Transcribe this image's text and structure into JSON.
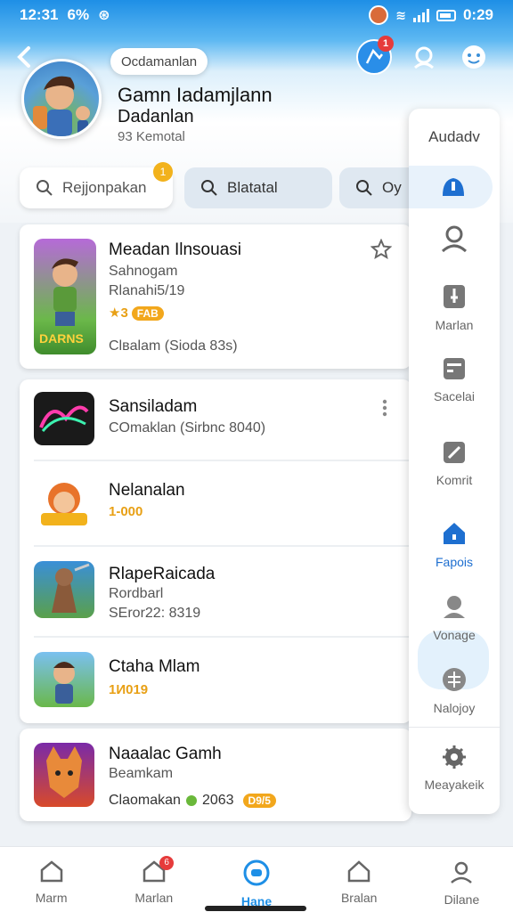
{
  "status_bar": {
    "time": "12:31",
    "left_extra": "6%",
    "right_time": "0:29"
  },
  "header": {
    "tag_label": "Ocdamanlan",
    "notification_count": "1",
    "profile": {
      "name": "Gamn Iadamjlann",
      "subtitle": "Dadanlan",
      "meta": "93 Kemotal"
    }
  },
  "search_chips": [
    {
      "label": "Rejjonpakan",
      "badge": "1"
    },
    {
      "label": "Blatatal"
    },
    {
      "label": "Oy"
    }
  ],
  "games_featured": {
    "title": "Meadan Ilnsouasi",
    "line1": "Sahnogam",
    "line2": "Rlanahi5/19",
    "rating": "3",
    "rating_badge": "FAB",
    "footer": "Clвalam (Sioda 83s)",
    "thumb_text": "DARNS"
  },
  "games_list": [
    {
      "title": "Sansiladam",
      "line1": "COmaklan (Sirbnc 8040)"
    },
    {
      "title": "Nelanalan",
      "rating": "1-000"
    },
    {
      "title": "RlapeRaicada",
      "line1": "Rordbarl",
      "line2": "SEror22: 8319"
    },
    {
      "title": "Ctaha Mlam",
      "rating": "1И019"
    }
  ],
  "games_last": {
    "title": "Naaalac Gamh",
    "line1": "Beamkam",
    "footer": "Claomakan",
    "score": "2063",
    "badge": "D9/5"
  },
  "side_panel": {
    "title": "Audadv",
    "items": [
      {
        "label": "Marlan",
        "icon": "piece-icon"
      },
      {
        "label": "Sacelai",
        "icon": "calendar-icon"
      },
      {
        "label": "Komrit",
        "icon": "pencil-icon"
      },
      {
        "label": "Fapois",
        "icon": "home-icon"
      },
      {
        "label": "Vonage",
        "icon": "person-icon"
      },
      {
        "label": "Nalojoy",
        "icon": "grid-icon"
      },
      {
        "label": "Meayakeik",
        "icon": "gear-icon"
      }
    ]
  },
  "bottom_nav": [
    {
      "label": "Marm",
      "icon": "home-icon"
    },
    {
      "label": "Marlan",
      "icon": "house-badge-icon",
      "badge": "6"
    },
    {
      "label": "Hane",
      "icon": "chat-icon"
    },
    {
      "label": "Bralan",
      "icon": "house-outline-icon"
    },
    {
      "label": "Dilane",
      "icon": "profile-icon"
    }
  ],
  "colors": {
    "accent": "#1e8fe6",
    "badge": "#f2a71c",
    "notification": "#e63b3b"
  }
}
